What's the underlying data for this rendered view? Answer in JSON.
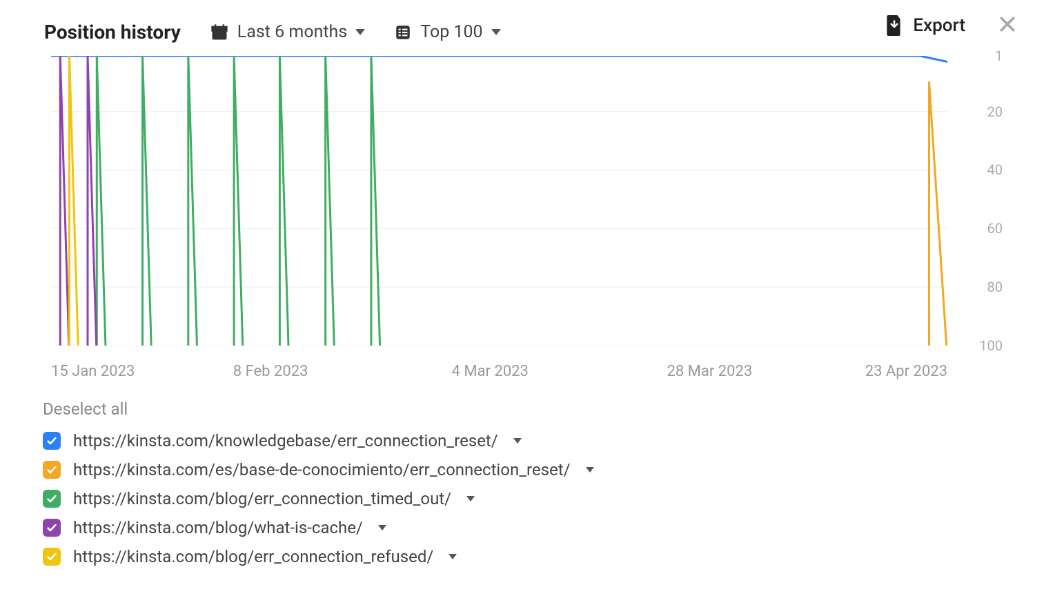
{
  "header": {
    "title": "Position history",
    "date_filter_label": "Last 6 months",
    "top_filter_label": "Top 100",
    "export_label": "Export"
  },
  "legend": {
    "deselect_label": "Deselect all",
    "items": [
      {
        "color": "#2d7ff9",
        "url": "https://kinsta.com/knowledgebase/err_connection_reset/"
      },
      {
        "color": "#f5a623",
        "url": "https://kinsta.com/es/base-de-conocimiento/err_connection_reset/"
      },
      {
        "color": "#3fae63",
        "url": "https://kinsta.com/blog/err_connection_timed_out/"
      },
      {
        "color": "#8e44ad",
        "url": "https://kinsta.com/blog/what-is-cache/"
      },
      {
        "color": "#f1c40f",
        "url": "https://kinsta.com/blog/err_connection_refused/"
      }
    ]
  },
  "chart_data": {
    "type": "line",
    "title": "Position history",
    "xlabel": "",
    "ylabel": "",
    "ylim": [
      1,
      100
    ],
    "y_inverted": true,
    "y_ticks": [
      1,
      20,
      40,
      60,
      80,
      100
    ],
    "x_range": [
      "2023-01-15",
      "2023-04-23"
    ],
    "x_tick_labels": [
      "15 Jan 2023",
      "8 Feb 2023",
      "4 Mar 2023",
      "28 Mar 2023",
      "23 Apr 2023"
    ],
    "series": [
      {
        "name": "https://kinsta.com/knowledgebase/err_connection_reset/",
        "color": "#2d7ff9",
        "notes": "Holds position ~1 across the whole period; slight dip to ~3 at the very end.",
        "points_est": [
          {
            "x": "2023-01-15",
            "y": 1
          },
          {
            "x": "2023-04-20",
            "y": 1
          },
          {
            "x": "2023-04-23",
            "y": 3
          }
        ]
      },
      {
        "name": "https://kinsta.com/es/base-de-conocimiento/err_connection_reset/",
        "color": "#f5a623",
        "notes": "Absent (>100) almost the whole range; a single narrow spike up to ~10 around 21–22 Apr 2023, then drops out again.",
        "points_est": [
          {
            "x": "2023-04-20",
            "y": null
          },
          {
            "x": "2023-04-21",
            "y": 10
          },
          {
            "x": "2023-04-23",
            "y": null
          }
        ]
      },
      {
        "name": "https://kinsta.com/blog/err_connection_timed_out/",
        "color": "#3fae63",
        "notes": "Repeated in/out spikes between mid-Jan and mid-Feb, each reaching ~position 1 then falling out of top 100; absent after mid-Feb.",
        "points_est": [
          {
            "x": "2023-01-19",
            "y": null
          },
          {
            "x": "2023-01-20",
            "y": 1
          },
          {
            "x": "2023-01-21",
            "y": null
          },
          {
            "x": "2023-01-24",
            "y": null
          },
          {
            "x": "2023-01-25",
            "y": 1
          },
          {
            "x": "2023-01-26",
            "y": null
          },
          {
            "x": "2023-01-29",
            "y": null
          },
          {
            "x": "2023-01-30",
            "y": 1
          },
          {
            "x": "2023-01-31",
            "y": null
          },
          {
            "x": "2023-02-03",
            "y": null
          },
          {
            "x": "2023-02-04",
            "y": 1
          },
          {
            "x": "2023-02-05",
            "y": null
          },
          {
            "x": "2023-02-08",
            "y": null
          },
          {
            "x": "2023-02-09",
            "y": 1
          },
          {
            "x": "2023-02-10",
            "y": null
          },
          {
            "x": "2023-02-13",
            "y": null
          },
          {
            "x": "2023-02-14",
            "y": 1
          },
          {
            "x": "2023-02-15",
            "y": null
          },
          {
            "x": "2023-02-18",
            "y": null
          },
          {
            "x": "2023-02-19",
            "y": 1
          },
          {
            "x": "2023-02-20",
            "y": null
          }
        ]
      },
      {
        "name": "https://kinsta.com/blog/what-is-cache/",
        "color": "#8e44ad",
        "notes": "Two narrow spikes to ~position 1 around 15–16 Jan and 18–19 Jan 2023; absent otherwise.",
        "points_est": [
          {
            "x": "2023-01-15",
            "y": null
          },
          {
            "x": "2023-01-16",
            "y": 1
          },
          {
            "x": "2023-01-17",
            "y": null
          },
          {
            "x": "2023-01-18",
            "y": null
          },
          {
            "x": "2023-01-19",
            "y": 1
          },
          {
            "x": "2023-01-20",
            "y": null
          }
        ]
      },
      {
        "name": "https://kinsta.com/blog/err_connection_refused/",
        "color": "#f1c40f",
        "notes": "Single narrow spike to ~position 1 around 17 Jan 2023; absent otherwise.",
        "points_est": [
          {
            "x": "2023-01-16",
            "y": null
          },
          {
            "x": "2023-01-17",
            "y": 1
          },
          {
            "x": "2023-01-18",
            "y": null
          }
        ]
      }
    ]
  }
}
